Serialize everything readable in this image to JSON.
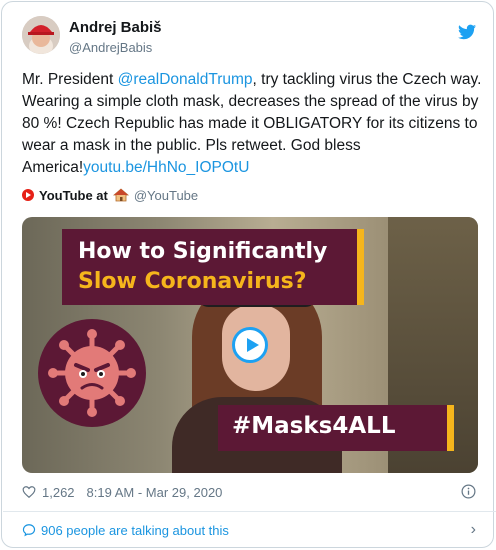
{
  "author": {
    "name": "Andrej Babiš",
    "handle": "@AndrejBabis"
  },
  "tweet": {
    "text_before": "Mr. President ",
    "mention": "@realDonaldTrump",
    "text_after": ", try tackling virus the Czech way. Wearing a simple cloth mask, decreases the spread of the virus by 80 %! Czech Republic has made it OBLIGATORY for its citizens to wear a mask in the public. Pls retweet. God bless America!",
    "link": "youtu.be/HhNo_IOPOtU"
  },
  "card_source": {
    "name": "YouTube at",
    "handle": "@YouTube"
  },
  "video": {
    "title_line1": "How to Significantly",
    "title_line2": "Slow Coronavirus?",
    "hashtag": "#Masks4ALL"
  },
  "meta": {
    "likes": "1,262",
    "timestamp": "8:19 AM - Mar 29, 2020"
  },
  "footer": {
    "talking": "906 people are talking about this"
  },
  "colors": {
    "link": "#1b95e0",
    "banner": "#5c1835",
    "banner_accent": "#f5b51c"
  }
}
